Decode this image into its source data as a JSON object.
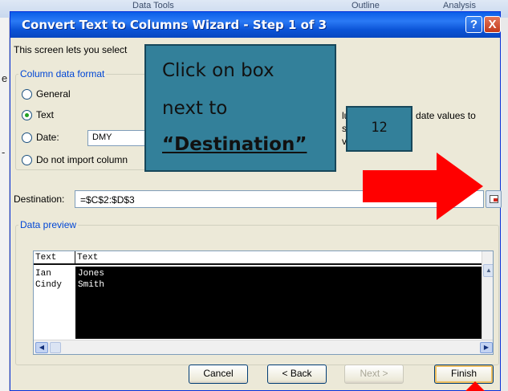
{
  "background": {
    "ribbon_labels": [
      "Data Tools",
      "Outline",
      "Analysis"
    ],
    "left_letters": [
      "e",
      "-"
    ]
  },
  "dialog": {
    "title": "Convert Text to Columns Wizard - Step 1 of 3",
    "help_label": "?",
    "close_label": "X",
    "intro": "This screen lets you select",
    "format_group_label": "Column data format",
    "options": [
      {
        "label": "General",
        "selected": false
      },
      {
        "label": "Text",
        "selected": true
      },
      {
        "label": "Date:",
        "selected": false
      },
      {
        "label": "Do not import column",
        "selected": false
      }
    ],
    "date_format": "DMY",
    "description": "lues to numbers, date values to",
    "description_line2": "s",
    "description_line3": "va",
    "destination_label": "Destination:",
    "destination_value": "=$C$2:$D$3",
    "preview_label": "Data preview",
    "preview_headers": [
      "Text",
      "Text"
    ],
    "preview_rows": [
      [
        "Ian",
        "Jones"
      ],
      [
        "Cindy",
        "Smith"
      ]
    ],
    "buttons": {
      "cancel": "Cancel",
      "back": "< Back",
      "next": "Next >",
      "finish": "Finish"
    }
  },
  "callout": {
    "line1": "Click on box",
    "line2": "next to",
    "line3": "“Destination”",
    "step_number": "12"
  },
  "colors": {
    "callout_bg": "#33809a",
    "arrow": "#ff0000",
    "title_bar": "#0a5ee8"
  }
}
